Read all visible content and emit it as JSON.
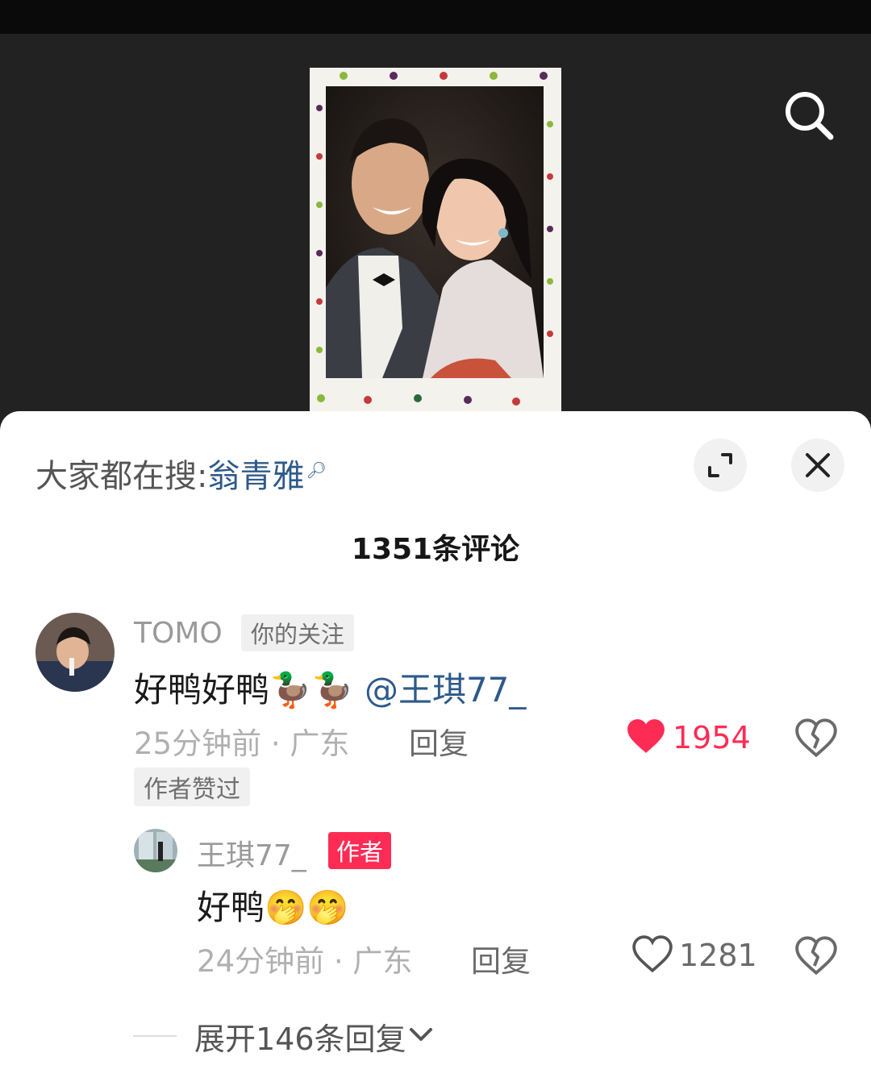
{
  "video": {
    "search_icon": "search-icon"
  },
  "sheet": {
    "hot_search_prefix": "大家都在搜:",
    "hot_search_term": "翁青雅",
    "expand_icon": "expand-icon",
    "close_icon": "close-icon",
    "comment_count_title": "1351条评论"
  },
  "comments": [
    {
      "username": "TOMO",
      "tag": "你的关注",
      "text": "好鸭好鸭🦆🦆",
      "mention": "@王琪77_",
      "meta": "25分钟前 · 广东",
      "reply_label": "回复",
      "likes": "1954",
      "liked": true,
      "liked_color": "#fe2c55",
      "author_liked_badge": "作者赞过",
      "replies": [
        {
          "username": "王琪77_",
          "tag": "作者",
          "text": "好鸭🤭🤭",
          "meta": "24分钟前 · 广东",
          "reply_label": "回复",
          "likes": "1281",
          "liked": false
        }
      ],
      "expand_replies_label": "展开146条回复"
    }
  ]
}
